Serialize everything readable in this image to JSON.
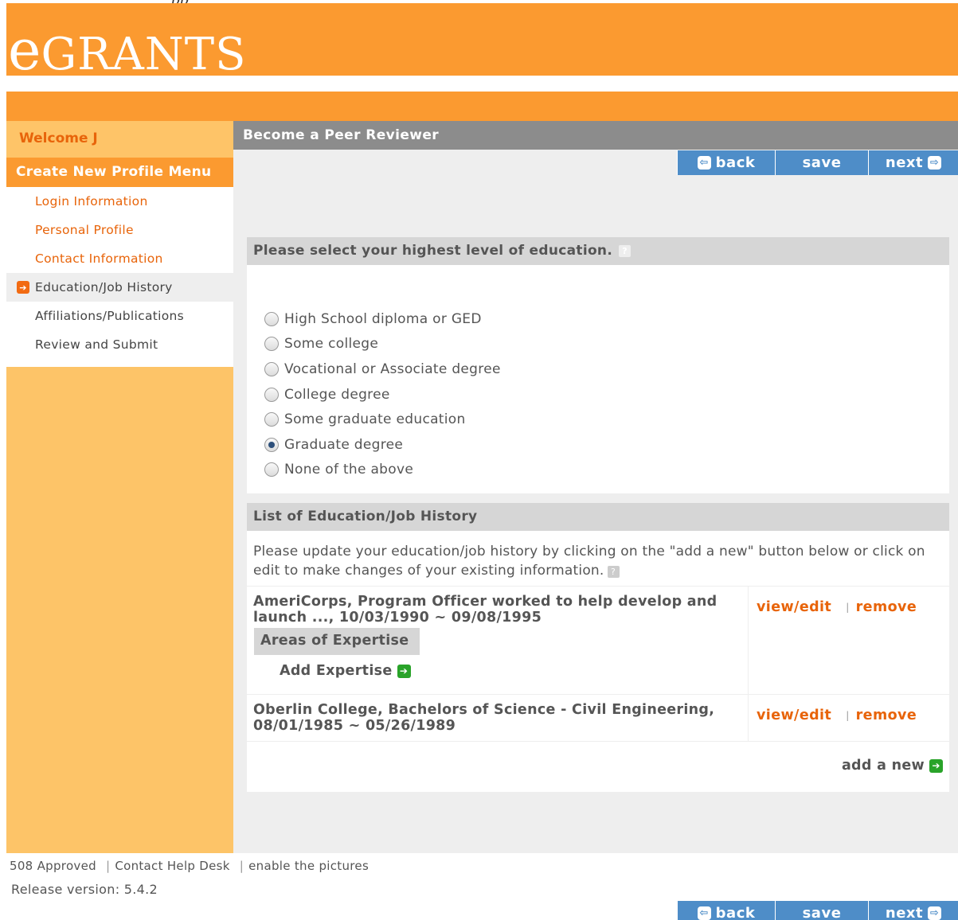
{
  "top_fragment": "pp",
  "logo": {
    "first": "e",
    "rest": "GRANTS"
  },
  "sidebar": {
    "welcome": "Welcome J",
    "menu_title": "Create New Profile Menu",
    "items": [
      {
        "label": "Login Information",
        "state": "link"
      },
      {
        "label": "Personal Profile",
        "state": "link"
      },
      {
        "label": "Contact Information",
        "state": "link"
      },
      {
        "label": "Education/Job History",
        "state": "active"
      },
      {
        "label": "Affiliations/Publications",
        "state": "plain"
      },
      {
        "label": "Review and Submit",
        "state": "plain"
      }
    ]
  },
  "page_title": "Become a Peer Reviewer",
  "nav": {
    "back": "back",
    "save": "save",
    "next": "next"
  },
  "education": {
    "question": "Please select your highest level of education.",
    "options": [
      "High School diploma or GED",
      "Some college",
      "Vocational or Associate degree",
      "College degree",
      "Some graduate education",
      "Graduate degree",
      "None of the above"
    ],
    "selected": "Graduate degree"
  },
  "history": {
    "header": "List of Education/Job History",
    "intro": "Please update your education/job history by clicking on the \"add a new\" button below or click on edit to make changes of your existing information.",
    "records": [
      {
        "line1": "AmeriCorps, Program Officer worked to help develop and",
        "line2": "launch ..., 10/03/1990 ~ 09/08/1995",
        "view_edit": "view/edit",
        "remove": "remove",
        "expertise_label": "Areas of Expertise",
        "add_expertise": "Add Expertise"
      },
      {
        "line1": "Oberlin College, Bachelors of Science - Civil Engineering,",
        "line2": "08/01/1985 ~ 05/26/1989",
        "view_edit": "view/edit",
        "remove": "remove"
      }
    ],
    "add_new": "add a new"
  },
  "footer": {
    "links": [
      "508 Approved",
      "Contact Help Desk",
      "enable the pictures"
    ],
    "release": "Release version: 5.4.2"
  },
  "colors": {
    "brand_orange": "#fb9a30",
    "sidebar_yellow": "#fdc468",
    "link_orange": "#e8640a",
    "button_blue": "#4e8dc8",
    "add_green": "#29a329"
  }
}
